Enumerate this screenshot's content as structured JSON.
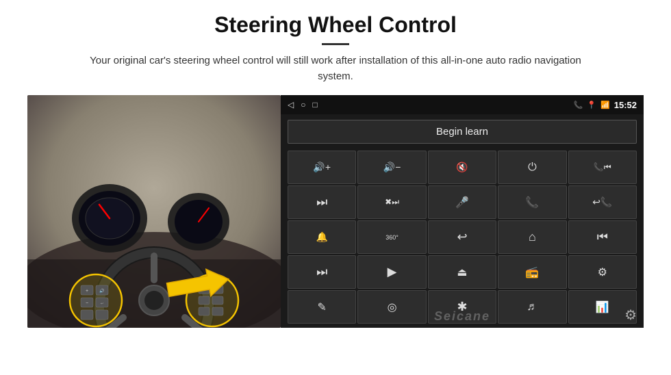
{
  "header": {
    "title": "Steering Wheel Control",
    "subtitle": "Your original car's steering wheel control will still work after installation of this all-in-one auto radio navigation system."
  },
  "status_bar": {
    "time": "15:52",
    "back_icon": "◁",
    "home_icon": "○",
    "recent_icon": "□"
  },
  "begin_learn": {
    "label": "Begin learn"
  },
  "controls": [
    {
      "icon": "🔊+",
      "name": "vol-up"
    },
    {
      "icon": "🔊−",
      "name": "vol-down"
    },
    {
      "icon": "🔇",
      "name": "mute"
    },
    {
      "icon": "⏻",
      "name": "power"
    },
    {
      "icon": "📞⏮",
      "name": "call-prev"
    },
    {
      "icon": "⏭",
      "name": "next-track"
    },
    {
      "icon": "⏯✖",
      "name": "play-stop"
    },
    {
      "icon": "🎤",
      "name": "mic"
    },
    {
      "icon": "📞",
      "name": "call"
    },
    {
      "icon": "📞↩",
      "name": "hang-up"
    },
    {
      "icon": "📢",
      "name": "horn"
    },
    {
      "icon": "360°",
      "name": "camera-360"
    },
    {
      "icon": "↩",
      "name": "back"
    },
    {
      "icon": "🏠",
      "name": "home"
    },
    {
      "icon": "⏮⏮",
      "name": "prev-prev"
    },
    {
      "icon": "⏭⏭",
      "name": "fast-fwd"
    },
    {
      "icon": "▶",
      "name": "nav"
    },
    {
      "icon": "⏏",
      "name": "eject"
    },
    {
      "icon": "📻",
      "name": "radio"
    },
    {
      "icon": "⚙",
      "name": "settings-ctrl"
    },
    {
      "icon": "✏",
      "name": "write"
    },
    {
      "icon": "🎯",
      "name": "target"
    },
    {
      "icon": "✱",
      "name": "bluetooth"
    },
    {
      "icon": "♪",
      "name": "music"
    },
    {
      "icon": "📊",
      "name": "equalizer"
    }
  ],
  "watermark": "Seicane",
  "gear_icon": "⚙"
}
